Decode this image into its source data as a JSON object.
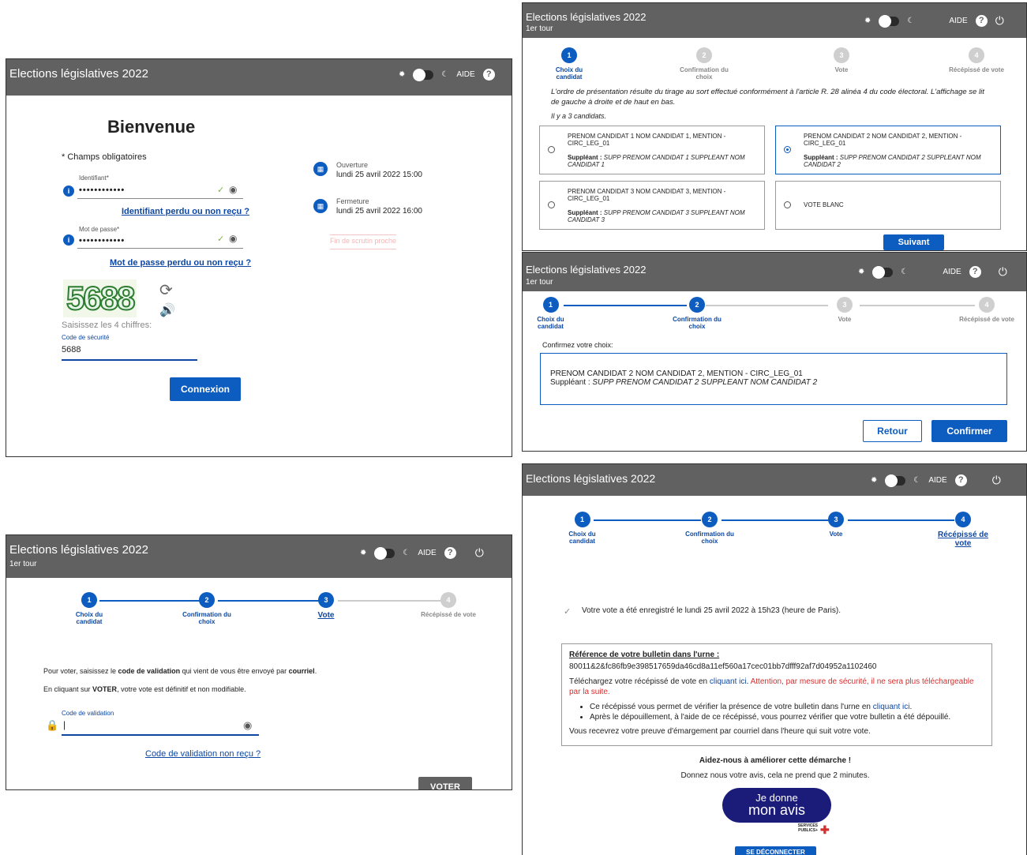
{
  "app_title": "Elections législatives 2022",
  "round": "1er tour",
  "help_label": "AIDE",
  "login": {
    "welcome": "Bienvenue",
    "required_note": "* Champs obligatoires",
    "id_label": "Identifiant*",
    "id_value": "••••••••••••",
    "id_lost": "Identifiant perdu ou non reçu ?",
    "pw_label": "Mot de passe*",
    "pw_value": "••••••••••••",
    "pw_lost": "Mot de passe perdu ou non reçu ?",
    "captcha_text": "5688",
    "captcha_hint": "Saisissez les 4 chiffres:",
    "security_label": "Code de sécurité",
    "security_value": "5688",
    "submit": "Connexion",
    "open_label": "Ouverture",
    "open_value": "lundi 25 avril 2022 15:00",
    "close_label": "Fermeture",
    "close_value": "lundi 25 avril 2022 16:00",
    "closing_soon": "Fin de scrutin proche"
  },
  "steps": [
    "Choix du candidat",
    "Confirmation du choix",
    "Vote",
    "Récépissé de vote"
  ],
  "choice": {
    "order_note": "L'ordre de présentation résulte du tirage au sort effectué conformément à l'article R. 28 alinéa 4 du code électoral. L'affichage se lit de gauche à droite et de haut en bas.",
    "count": "Il y a 3 candidats.",
    "candidates": [
      {
        "name": "PRENOM CANDIDAT 1 NOM CANDIDAT 1, MENTION - CIRC_LEG_01",
        "sub": "SUPP PRENOM CANDIDAT 1 SUPPLEANT NOM CANDIDAT 1",
        "selected": false
      },
      {
        "name": "PRENOM CANDIDAT 2 NOM CANDIDAT 2, MENTION - CIRC_LEG_01",
        "sub": "SUPP PRENOM CANDIDAT 2 SUPPLEANT NOM CANDIDAT 2",
        "selected": true
      },
      {
        "name": "PRENOM CANDIDAT 3 NOM CANDIDAT 3, MENTION - CIRC_LEG_01",
        "sub": "SUPP PRENOM CANDIDAT 3 SUPPLEANT NOM CANDIDAT 3",
        "selected": false
      }
    ],
    "sub_prefix": "Suppléant : ",
    "blank": "VOTE BLANC",
    "next": "Suivant"
  },
  "confirm": {
    "prompt": "Confirmez votre choix:",
    "line1": "PRENOM CANDIDAT 2 NOM CANDIDAT 2, MENTION - CIRC_LEG_01",
    "line2_prefix": "Suppléant : ",
    "line2": "SUPP PRENOM CANDIDAT 2 SUPPLEANT NOM CANDIDAT 2",
    "back": "Retour",
    "confirm": "Confirmer"
  },
  "vote": {
    "instr1_a": "Pour voter, saisissez le ",
    "instr1_b": "code de validation",
    "instr1_c": " qui vient de vous être envoyé par ",
    "instr1_d": "courriel",
    "instr1_e": ".",
    "instr2_a": "En cliquant sur ",
    "instr2_b": "VOTER",
    "instr2_c": ", votre vote est définitif et non modifiable.",
    "code_label": "Code de validation",
    "code_value": "|",
    "not_received": "Code de validation non reçu ?",
    "submit": "VOTER"
  },
  "receipt": {
    "saved": "Votre vote a été enregistré le lundi 25 avril 2022 à 15h23 (heure de Paris).",
    "ref_title": "Référence de votre bulletin dans l'urne :",
    "ref_value": "80011&2&fc86fb9e398517659da46cd8a11ef560a17cec01bb7dfff92af7d04952a1102460",
    "dl_a": "Téléchargez votre récépissé de vote en ",
    "dl_link": "cliquant ici",
    "dl_b": ".",
    "warn": "Attention, par mesure de sécurité, il ne sera plus téléchargeable par la suite.",
    "b1_a": "Ce récépissé vous permet de vérifier la présence de votre bulletin dans l'urne en ",
    "b1_link": "cliquant ici",
    "b1_b": ".",
    "b2": "Après le dépouillement, à l'aide de ce récépissé, vous pourrez vérifier que votre bulletin a été dépouillé.",
    "proof": "Vous recevrez votre preuve d'émargement par courriel dans l'heure qui suit votre vote.",
    "help_title": "Aidez-nous à améliorer cette démarche !",
    "help_sub": "Donnez nous votre avis, cela ne prend que 2 minutes.",
    "badge_1": "Je donne",
    "badge_2": "mon avis",
    "badge_brand": "SERVICES PUBLICS+",
    "logout": "SE DÉCONNECTER"
  },
  "colors": {
    "header": "#616161",
    "accent": "#0d5cc0",
    "warning": "#d32f2f"
  }
}
